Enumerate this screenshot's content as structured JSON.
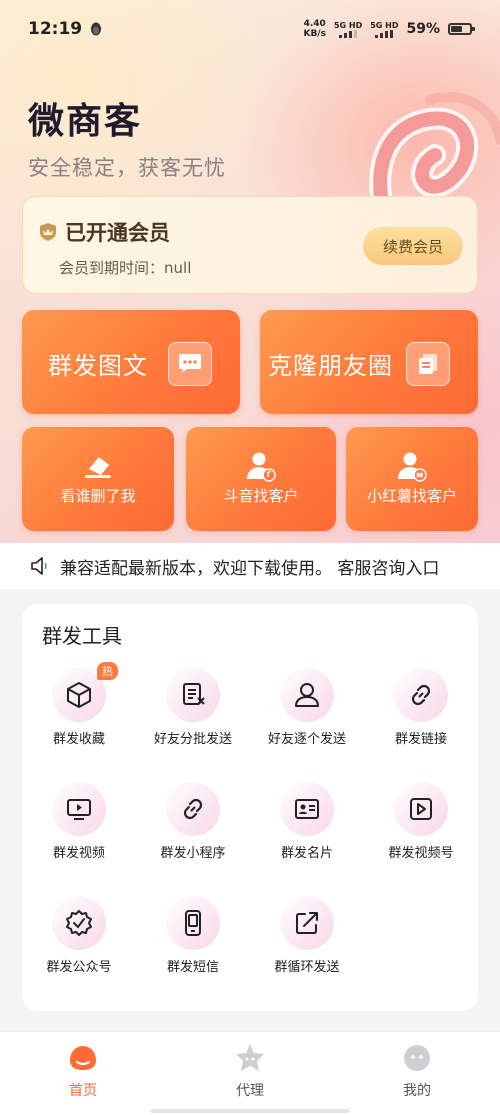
{
  "status_bar": {
    "time": "12:19",
    "net_speed_value": "4.40",
    "net_speed_unit": "KB/s",
    "sim1": "5G HD",
    "sim2": "5G HD",
    "battery": "59%"
  },
  "header": {
    "title": "微商客",
    "subtitle": "安全稳定，获客无忧"
  },
  "vip": {
    "status": "已开通会员",
    "expire_label": "会员到期时间：",
    "expire_value": "null",
    "renew_button": "续费会员"
  },
  "big_tiles": [
    {
      "label": "群发图文",
      "icon": "chat-bubble-icon"
    },
    {
      "label": "克隆朋友圈",
      "icon": "copy-document-icon"
    }
  ],
  "small_tiles": [
    {
      "label": "看谁删了我",
      "icon": "eraser-icon"
    },
    {
      "label": "斗音找客户",
      "icon": "user-music-icon"
    },
    {
      "label": "小红薯找客户",
      "icon": "user-tag-icon"
    }
  ],
  "notice": {
    "icon": "speaker-icon",
    "text": "兼容适配最新版本，欢迎下载使用。 客服咨询入口"
  },
  "tools": {
    "title": "群发工具",
    "hot_badge": "热",
    "items": [
      {
        "label": "群发收藏",
        "icon": "cube-icon"
      },
      {
        "label": "好友分批发送",
        "icon": "document-list-icon"
      },
      {
        "label": "好友逐个发送",
        "icon": "user-outline-icon"
      },
      {
        "label": "群发链接",
        "icon": "link-icon"
      },
      {
        "label": "群发视频",
        "icon": "video-monitor-icon"
      },
      {
        "label": "群发小程序",
        "icon": "link-chain-icon"
      },
      {
        "label": "群发名片",
        "icon": "id-card-icon"
      },
      {
        "label": "群发视频号",
        "icon": "play-square-icon"
      },
      {
        "label": "群发公众号",
        "icon": "badge-check-icon"
      },
      {
        "label": "群发短信",
        "icon": "phone-icon"
      },
      {
        "label": "群循环发送",
        "icon": "share-external-icon"
      }
    ]
  },
  "bottom_nav": {
    "items": [
      {
        "label": "首页",
        "icon": "home-icon",
        "active": true
      },
      {
        "label": "代理",
        "icon": "star-face-icon",
        "active": false
      },
      {
        "label": "我的",
        "icon": "profile-face-icon",
        "active": false
      }
    ]
  },
  "colors": {
    "accent": "#ff6a35",
    "tile_gradient_start": "#ff9a4f",
    "vip_bg": "#fff6e4",
    "renew_btn": "#f8c87b"
  }
}
